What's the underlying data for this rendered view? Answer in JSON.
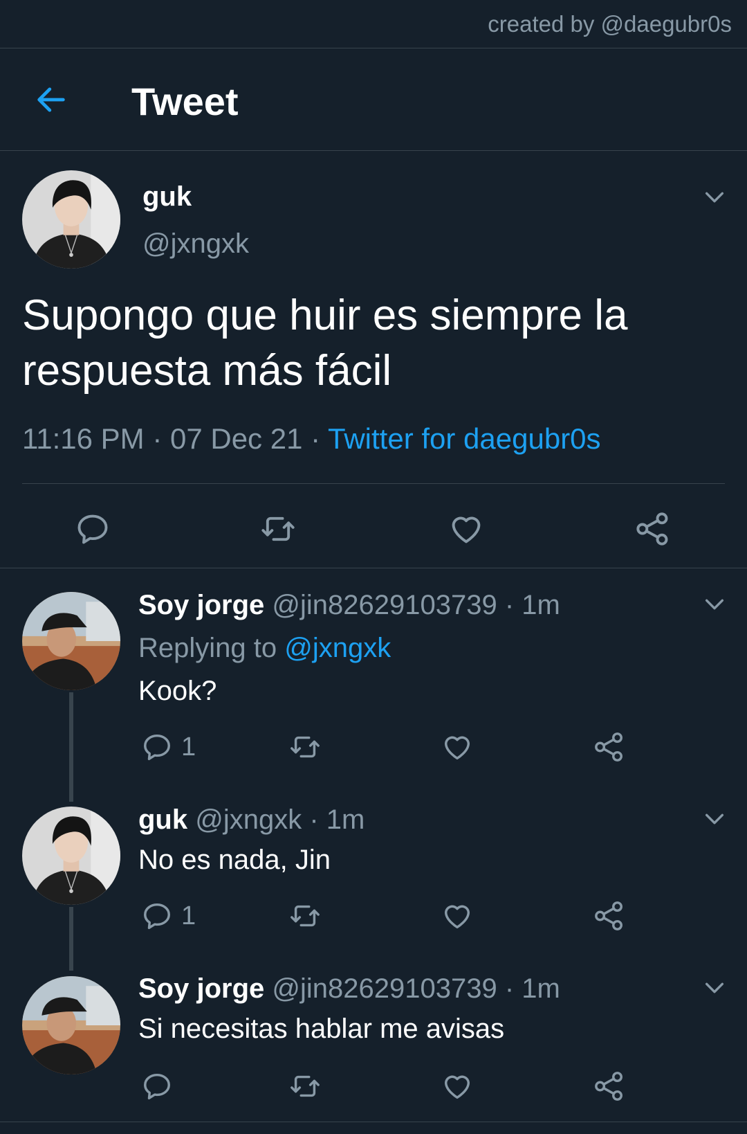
{
  "credit": "created by @daegubr0s",
  "header": {
    "title": "Tweet",
    "back_icon": "arrow-left-icon"
  },
  "colors": {
    "background": "#15202b",
    "accent": "#1da1f2",
    "muted": "#8899a6",
    "divider": "#38444d"
  },
  "main_tweet": {
    "name": "guk",
    "handle": "@jxngxk",
    "text": "Supongo que huir es siempre la respuesta más fácil",
    "time": "11:16 PM · 07 Dec 21 · ",
    "source": "Twitter for daegubr0s"
  },
  "replies": [
    {
      "name": "Soy jorge",
      "handle": " @jin82629103739 · 1m",
      "replying_label": "Replying to ",
      "replying_to": "@jxngxk",
      "text": "Kook?",
      "reply_count": "1"
    },
    {
      "name": "guk",
      "handle": " @jxngxk · 1m",
      "text": "No es nada, Jin",
      "reply_count": "1"
    },
    {
      "name": "Soy jorge",
      "handle": " @jin82629103739 · 1m",
      "text": "Si necesitas hablar me avisas",
      "reply_count": ""
    }
  ]
}
